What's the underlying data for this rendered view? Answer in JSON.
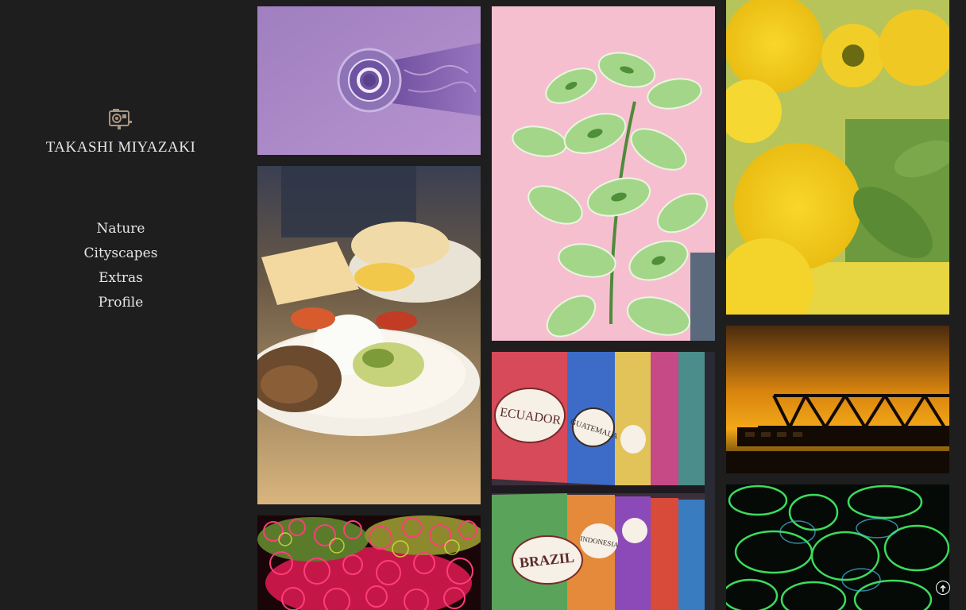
{
  "site": {
    "title": "TAKASHI MIYAZAKI",
    "logo_icon": "camera-icon"
  },
  "nav": {
    "items": [
      {
        "label": "Nature"
      },
      {
        "label": "Cityscapes"
      },
      {
        "label": "Extras"
      },
      {
        "label": "Profile"
      }
    ]
  },
  "gallery": {
    "photos": [
      {
        "subject": "glass-on-purple"
      },
      {
        "subject": "food-plate"
      },
      {
        "subject": "bubbles-colorful"
      },
      {
        "subject": "plant-on-pink"
      },
      {
        "subject": "coffee-bag-wall"
      },
      {
        "subject": "sunflowers"
      },
      {
        "subject": "bridge-sunset"
      },
      {
        "subject": "neon-bubbles"
      }
    ],
    "coffee_labels": [
      "ECUADOR",
      "GUATEMALA",
      "BRAZIL",
      "INDONESIA"
    ]
  },
  "scroll_top_icon": "arrow-up-circle-icon"
}
